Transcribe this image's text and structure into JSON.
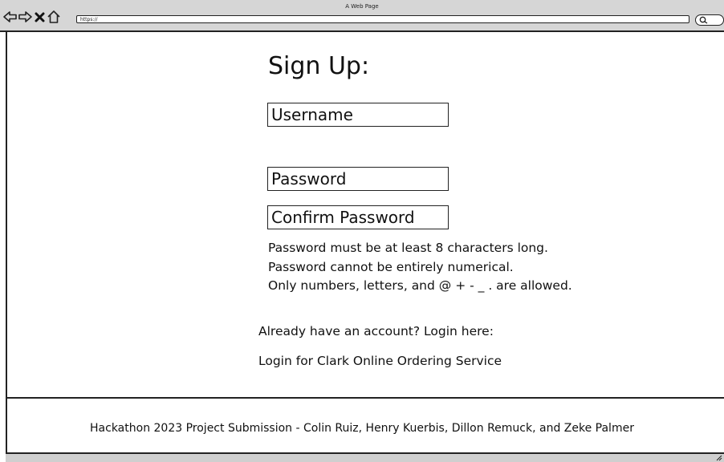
{
  "browser": {
    "title": "A Web Page",
    "url": "https://"
  },
  "main": {
    "heading": "Sign Up:",
    "username_placeholder": "Username",
    "password_placeholder": "Password",
    "confirm_password_placeholder": "Confirm Password",
    "rules": [
      "Password must be at least 8 characters long.",
      "Password cannot be entirely numerical.",
      "Only numbers, letters, and @ + - _ . are allowed."
    ],
    "login_prompt": "Already have an account? Login here:",
    "login_link": "Login for Clark Online Ordering Service"
  },
  "footer": {
    "text": "Hackathon 2023 Project Submission - Colin Ruiz, Henry Kuerbis, Dillon Remuck, and Zeke Palmer"
  }
}
